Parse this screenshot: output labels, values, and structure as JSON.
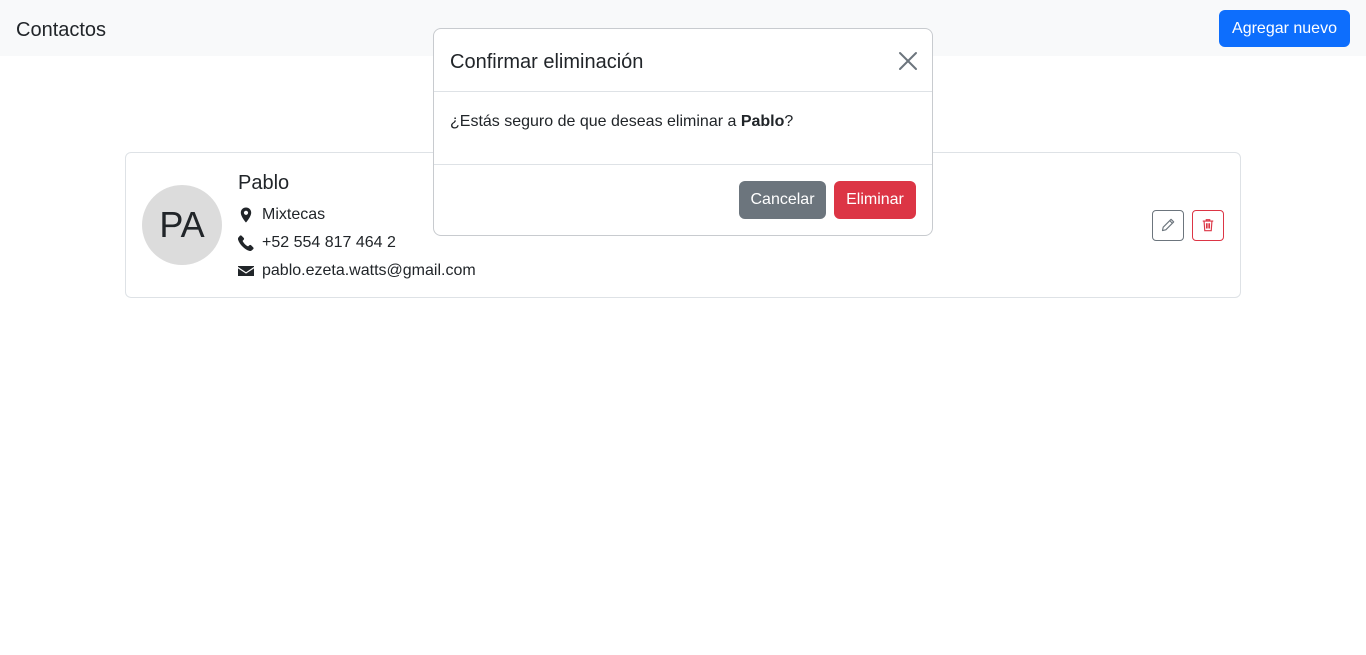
{
  "navbar": {
    "brand": "Contactos",
    "add_label": "Agregar nuevo"
  },
  "contact": {
    "initials": "PA",
    "name": "Pablo",
    "location": "Mixtecas",
    "phone": "+52 554 817 464 2",
    "email": "pablo.ezeta.watts@gmail.com"
  },
  "modal": {
    "title": "Confirmar eliminación",
    "message_prefix": "¿Estás seguro de que deseas eliminar a ",
    "message_name": "Pablo",
    "message_suffix": "?",
    "cancel_label": "Cancelar",
    "confirm_label": "Eliminar"
  },
  "colors": {
    "primary": "#0d6efd",
    "danger": "#dc3545",
    "secondary": "#6c757d",
    "navbar_bg": "#f8f9fa",
    "avatar_bg": "#dcdcdc"
  },
  "icons": {
    "location": "map-marker-icon",
    "phone": "phone-icon",
    "email": "envelope-icon",
    "edit": "pencil-icon",
    "delete": "trash-icon",
    "close": "close-icon"
  }
}
